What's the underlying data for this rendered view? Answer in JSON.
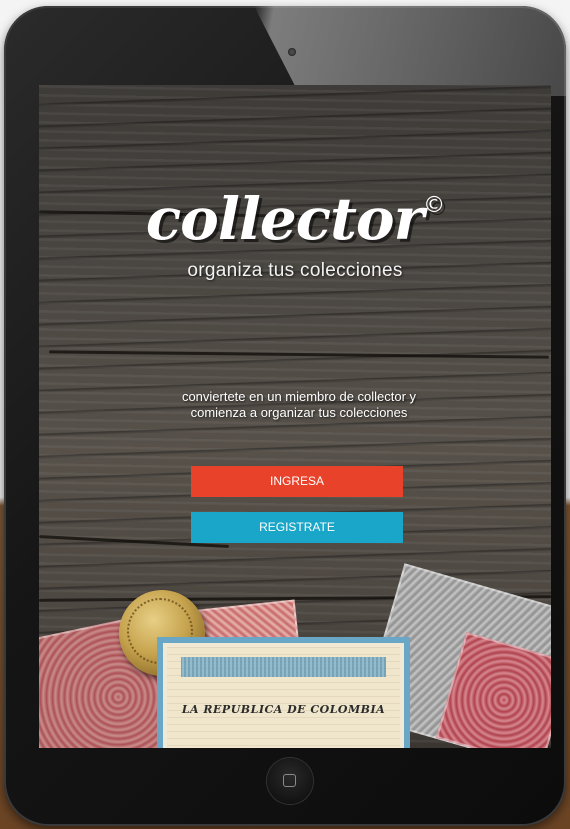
{
  "app": {
    "logo_text": "collector",
    "logo_symbol": "©",
    "tagline": "organiza tus colecciones"
  },
  "main": {
    "invite_text": "conviertete en un miembro de collector y comienza a organizar tus colecciones",
    "login_label": "INGRESA",
    "register_label": "REGISTRATE"
  },
  "artwork": {
    "banknote_title": "LA REPUBLICA DE COLOMBIA"
  },
  "colors": {
    "login_button": "#e8422b",
    "register_button": "#1aa6c8",
    "text": "#ffffff"
  }
}
